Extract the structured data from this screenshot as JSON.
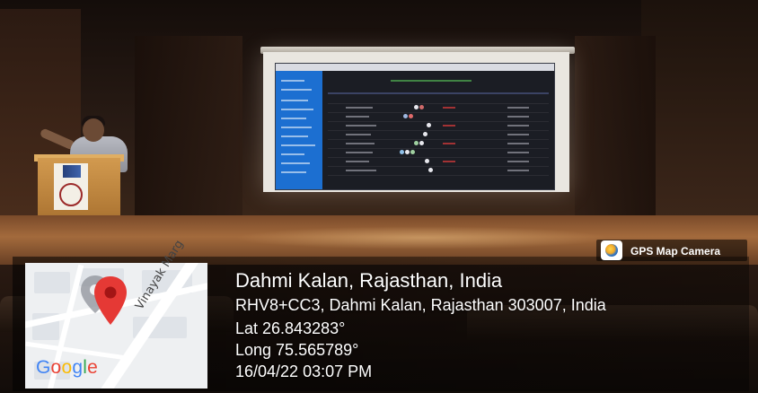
{
  "gps_overlay": {
    "badge_label": "GPS Map Camera",
    "place": "Dahmi Kalan, Rajasthan, India",
    "address": "RHV8+CC3, Dahmi Kalan, Rajasthan 303007, India",
    "latitude": "Lat 26.843283°",
    "longitude": "Long 75.565789°",
    "datetime": "16/04/22 03:07 PM"
  },
  "map": {
    "road_name": "Vinayak Marg",
    "logo_letters": [
      "G",
      "o",
      "o",
      "g",
      "l",
      "e"
    ],
    "logo_colors": [
      "#4285F4",
      "#EA4335",
      "#FBBC05",
      "#4285F4",
      "#34A853",
      "#EA4335"
    ],
    "pin_color": "#e53935"
  }
}
